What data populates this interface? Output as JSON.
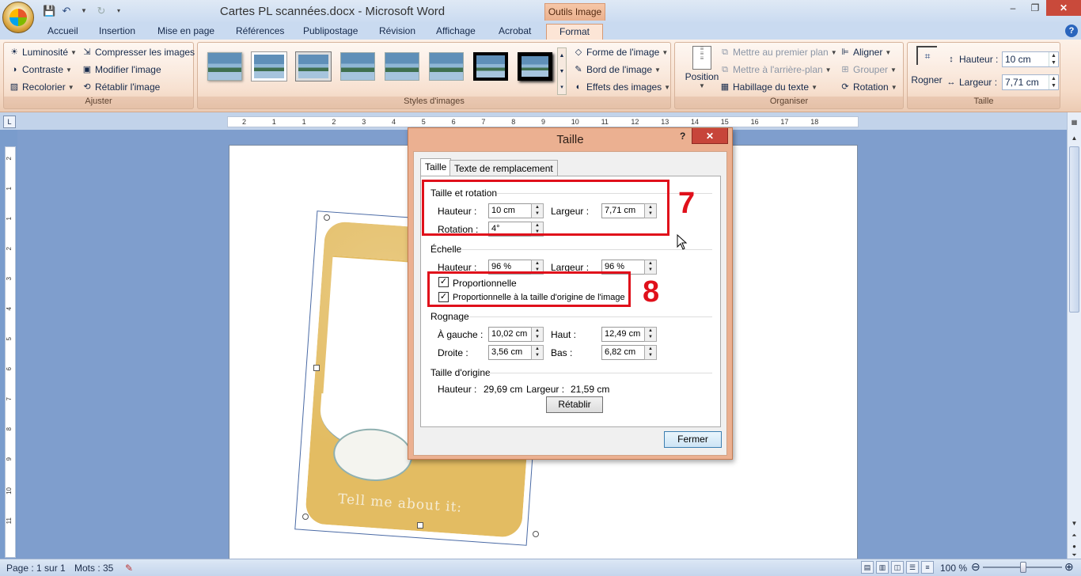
{
  "window": {
    "title": "Cartes PL scannées.docx - Microsoft Word",
    "context_tab": "Outils Image",
    "buttons": {
      "minimize": "–",
      "restore": "❐",
      "close": "✕"
    }
  },
  "ribbon": {
    "tabs": [
      "Accueil",
      "Insertion",
      "Mise en page",
      "Références",
      "Publipostage",
      "Révision",
      "Affichage",
      "Acrobat",
      "Format"
    ],
    "active_tab": "Format",
    "ajuster": {
      "label": "Ajuster",
      "luminosite": "Luminosité",
      "contraste": "Contraste",
      "recolorier": "Recolorier",
      "compresser": "Compresser les images",
      "modifier": "Modifier l'image",
      "retablir": "Rétablir l'image"
    },
    "styles": {
      "label": "Styles d'images",
      "forme": "Forme de l'image",
      "bord": "Bord de l'image",
      "effets": "Effets des images"
    },
    "organiser": {
      "label": "Organiser",
      "position": "Position",
      "premier_plan": "Mettre au premier plan",
      "arriere_plan": "Mettre à l'arrière-plan",
      "habillage": "Habillage du texte",
      "aligner": "Aligner",
      "grouper": "Grouper",
      "rotation": "Rotation"
    },
    "taille": {
      "label": "Taille",
      "rogner": "Rogner",
      "hauteur_label": "Hauteur :",
      "hauteur_value": "10 cm",
      "largeur_label": "Largeur :",
      "largeur_value": "7,71 cm"
    }
  },
  "ruler": {
    "h_labels": [
      "2",
      "1",
      "1",
      "2",
      "3",
      "4",
      "5",
      "6",
      "7",
      "8",
      "9",
      "10",
      "11",
      "12",
      "13",
      "14",
      "15",
      "16",
      "17",
      "18"
    ],
    "v_labels": [
      "2",
      "1",
      "1",
      "2",
      "3",
      "4",
      "5",
      "6",
      "7",
      "8",
      "9",
      "10",
      "11"
    ]
  },
  "document": {
    "card_caption": "Tell me about it:"
  },
  "dialog": {
    "title": "Taille",
    "help": "?",
    "close": "✕",
    "tabs": [
      "Taille",
      "Texte de remplacement"
    ],
    "taille_rotation": {
      "heading": "Taille et rotation",
      "hauteur_label": "Hauteur :",
      "hauteur_value": "10 cm",
      "largeur_label": "Largeur :",
      "largeur_value": "7,71 cm",
      "rotation_label": "Rotation :",
      "rotation_value": "4°"
    },
    "echelle": {
      "heading": "Échelle",
      "hauteur_label": "Hauteur :",
      "hauteur_value": "96 %",
      "largeur_label": "Largeur :",
      "largeur_value": "96 %",
      "proportionnelle": "Proportionnelle",
      "proportionnelle_checked": true,
      "proportionnelle_origine": "Proportionnelle à la taille d'origine de l'image",
      "proportionnelle_origine_checked": true
    },
    "rognage": {
      "heading": "Rognage",
      "gauche_label": "À gauche :",
      "gauche_value": "10,02 cm",
      "haut_label": "Haut :",
      "haut_value": "12,49 cm",
      "droite_label": "Droite :",
      "droite_value": "3,56 cm",
      "bas_label": "Bas :",
      "bas_value": "6,82 cm"
    },
    "origine": {
      "heading": "Taille d'origine",
      "hauteur_label": "Hauteur :",
      "hauteur_value": "29,69 cm",
      "largeur_label": "Largeur :",
      "largeur_value": "21,59 cm"
    },
    "retablir_button": "Rétablir",
    "fermer_button": "Fermer"
  },
  "annotations": {
    "box7": "7",
    "box8": "8",
    "color": "#e0101b"
  },
  "statusbar": {
    "page": "Page : 1 sur 1",
    "words": "Mots : 35",
    "zoom": "100 %"
  }
}
